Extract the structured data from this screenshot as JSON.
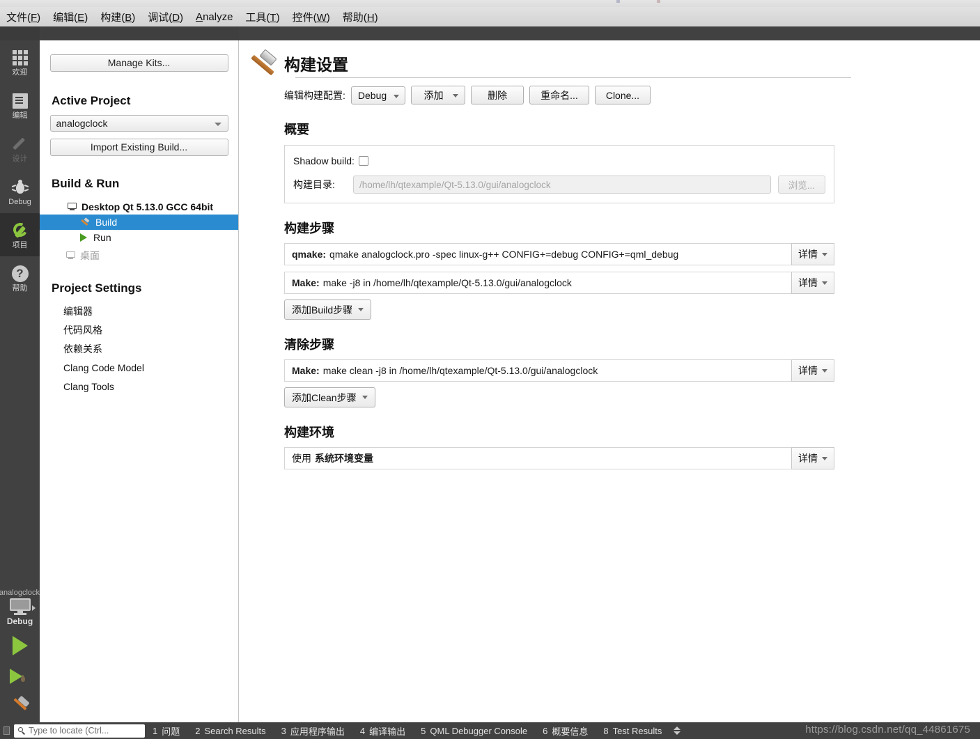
{
  "menubar": {
    "items": [
      {
        "label": "文件(F)",
        "mnemonic": "F"
      },
      {
        "label": "编辑(E)",
        "mnemonic": "E"
      },
      {
        "label": "构建(B)",
        "mnemonic": "B"
      },
      {
        "label": "调试(D)",
        "mnemonic": "D"
      },
      {
        "label": "Analyze",
        "mnemonic": "A"
      },
      {
        "label": "工具(T)",
        "mnemonic": "T"
      },
      {
        "label": "控件(W)",
        "mnemonic": "W"
      },
      {
        "label": "帮助(H)",
        "mnemonic": "H"
      }
    ]
  },
  "modebar": {
    "items": [
      {
        "label": "欢迎",
        "icon": "grid-icon",
        "state": "normal"
      },
      {
        "label": "编辑",
        "icon": "document-edit-icon",
        "state": "normal"
      },
      {
        "label": "设计",
        "icon": "pencil-icon",
        "state": "disabled"
      },
      {
        "label": "Debug",
        "icon": "bug-icon",
        "state": "normal"
      },
      {
        "label": "项目",
        "icon": "wrench-icon",
        "state": "selected"
      },
      {
        "label": "帮助",
        "icon": "question-mark-icon",
        "state": "normal"
      }
    ],
    "kit_selector": {
      "project": "analogclock",
      "icon": "desktop-monitor-icon",
      "build_config": "Debug"
    },
    "run_button_icon": "play-triangle-icon",
    "debug_button_icon": "play-triangle-with-bug-icon",
    "build_button_icon": "hammer-icon"
  },
  "sidebar": {
    "manage_kits_label": "Manage Kits...",
    "active_project_heading": "Active Project",
    "active_project_value": "analogclock",
    "import_existing_build_label": "Import Existing Build...",
    "build_run_heading": "Build & Run",
    "kit_name": "Desktop Qt 5.13.0 GCC 64bit",
    "kit_children": [
      {
        "label": "Build",
        "icon": "hammer-icon",
        "selected": true
      },
      {
        "label": "Run",
        "icon": "play-triangle-icon",
        "selected": false
      }
    ],
    "inactive_kit": {
      "label": "桌面",
      "icon": "desktop-disabled-icon"
    },
    "project_settings_heading": "Project Settings",
    "project_settings_items": [
      "编辑器",
      "代码风格",
      "依赖关系",
      "Clang Code Model",
      "Clang Tools"
    ]
  },
  "main": {
    "page_title": "构建设置",
    "page_icon": "hammer-icon",
    "toolbar": {
      "edit_config_label": "编辑构建配置:",
      "config_value": "Debug",
      "add_label": "添加",
      "remove_label": "删除",
      "rename_label": "重命名...",
      "clone_label": "Clone..."
    },
    "summary": {
      "heading": "概要",
      "shadow_build_label": "Shadow build:",
      "shadow_build_checked": false,
      "build_dir_label": "构建目录:",
      "build_dir_value": "/home/lh/qtexample/Qt-5.13.0/gui/analogclock",
      "browse_label": "浏览..."
    },
    "build_steps": {
      "heading": "构建步骤",
      "steps": [
        {
          "name": "qmake:",
          "command": "qmake analogclock.pro -spec linux-g++ CONFIG+=debug CONFIG+=qml_debug",
          "detail_label": "详情"
        },
        {
          "name": "Make:",
          "command": "make -j8 in /home/lh/qtexample/Qt-5.13.0/gui/analogclock",
          "detail_label": "详情"
        }
      ],
      "add_step_label": "添加Build步骤"
    },
    "clean_steps": {
      "heading": "清除步骤",
      "steps": [
        {
          "name": "Make:",
          "command": "make clean -j8 in /home/lh/qtexample/Qt-5.13.0/gui/analogclock",
          "detail_label": "详情"
        }
      ],
      "add_step_label": "添加Clean步骤"
    },
    "build_env": {
      "heading": "构建环境",
      "use_label": "使用",
      "env_name": "系统环境变量",
      "detail_label": "详情"
    }
  },
  "statusbar": {
    "locator_placeholder": "Type to locate (Ctrl...",
    "panes": [
      {
        "num": "1",
        "label": "问题"
      },
      {
        "num": "2",
        "label": "Search Results"
      },
      {
        "num": "3",
        "label": "应用程序输出"
      },
      {
        "num": "4",
        "label": "编译输出"
      },
      {
        "num": "5",
        "label": "QML Debugger Console"
      },
      {
        "num": "6",
        "label": "概要信息"
      },
      {
        "num": "8",
        "label": "Test Results"
      }
    ],
    "watermark": "https://blog.csdn.net/qq_44861675"
  },
  "colors": {
    "accent_selected": "#2a8bd0",
    "modebar_bg": "#414141",
    "green": "#8cc63f",
    "orange": "#d0883a"
  }
}
